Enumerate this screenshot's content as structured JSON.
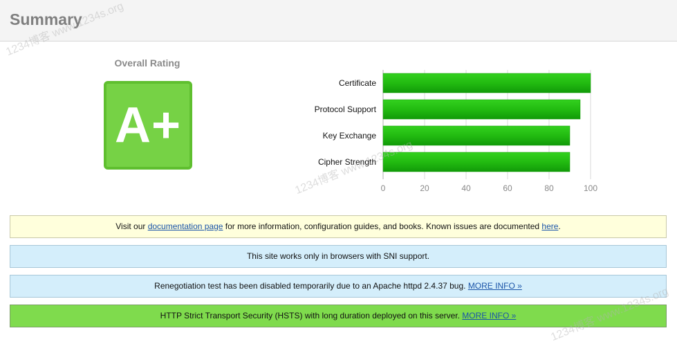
{
  "header": {
    "title": "Summary"
  },
  "rating": {
    "label": "Overall Rating",
    "grade": "A+"
  },
  "chart_data": {
    "type": "bar",
    "orientation": "horizontal",
    "categories": [
      "Certificate",
      "Protocol Support",
      "Key Exchange",
      "Cipher Strength"
    ],
    "values": [
      100,
      95,
      90,
      90
    ],
    "xlim": [
      0,
      100
    ],
    "xticks": [
      "0",
      "20",
      "40",
      "60",
      "80",
      "100"
    ],
    "grid": true,
    "bar_color": "#22bb11"
  },
  "banners": {
    "docs": {
      "prefix": "Visit our ",
      "link1": "documentation page",
      "middle": " for more information, configuration guides, and books. Known issues are documented ",
      "link2": "here",
      "suffix": "."
    },
    "sni": {
      "text": "This site works only in browsers with SNI support."
    },
    "renegotiation": {
      "text": "Renegotiation test has been disabled temporarily due to an Apache httpd 2.4.37 bug. ",
      "link": "MORE INFO »"
    },
    "hsts": {
      "text": "HTTP Strict Transport Security (HSTS) with long duration deployed on this server.  ",
      "link": "MORE INFO »"
    }
  },
  "colors": {
    "grade_fill": "#76d245",
    "grade_border": "#5fbf2f",
    "banner_yellow": "#ffffdc",
    "banner_blue": "#d4eefb",
    "banner_green": "#7fdb4d",
    "link": "#1a54a8"
  },
  "watermark": {
    "text": "1234博客 www.1234s.org"
  }
}
